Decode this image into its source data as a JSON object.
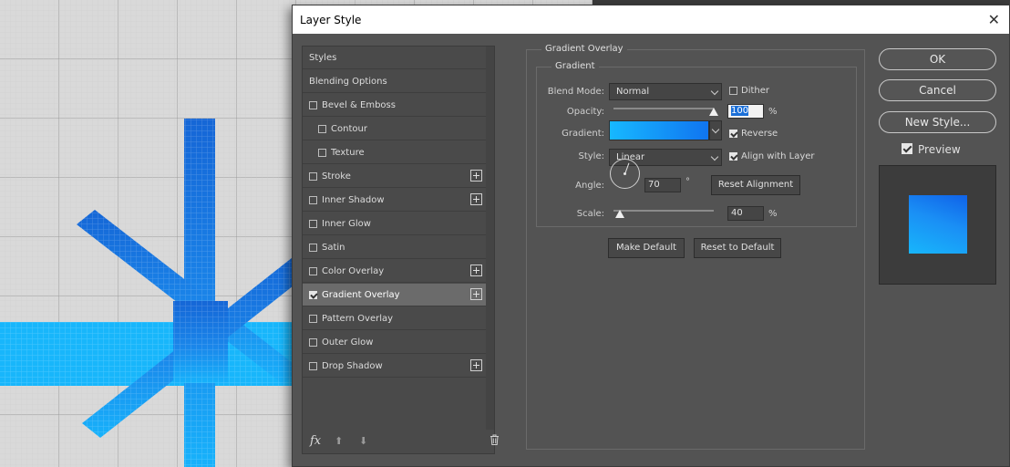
{
  "dialog": {
    "title": "Layer Style",
    "close_glyph": "✕"
  },
  "styles_list": [
    {
      "label": "Styles",
      "checkbox": false,
      "plus": false,
      "indent": 0
    },
    {
      "label": "Blending Options",
      "checkbox": false,
      "plus": false,
      "indent": 0
    },
    {
      "label": "Bevel & Emboss",
      "checkbox": true,
      "checked": false,
      "plus": false,
      "indent": 0
    },
    {
      "label": "Contour",
      "checkbox": true,
      "checked": false,
      "plus": false,
      "indent": 1
    },
    {
      "label": "Texture",
      "checkbox": true,
      "checked": false,
      "plus": false,
      "indent": 1
    },
    {
      "label": "Stroke",
      "checkbox": true,
      "checked": false,
      "plus": true,
      "indent": 0
    },
    {
      "label": "Inner Shadow",
      "checkbox": true,
      "checked": false,
      "plus": true,
      "indent": 0
    },
    {
      "label": "Inner Glow",
      "checkbox": true,
      "checked": false,
      "plus": false,
      "indent": 0
    },
    {
      "label": "Satin",
      "checkbox": true,
      "checked": false,
      "plus": false,
      "indent": 0
    },
    {
      "label": "Color Overlay",
      "checkbox": true,
      "checked": false,
      "plus": true,
      "indent": 0
    },
    {
      "label": "Gradient Overlay",
      "checkbox": true,
      "checked": true,
      "plus": true,
      "indent": 0,
      "selected": true
    },
    {
      "label": "Pattern Overlay",
      "checkbox": true,
      "checked": false,
      "plus": false,
      "indent": 0
    },
    {
      "label": "Outer Glow",
      "checkbox": true,
      "checked": false,
      "plus": false,
      "indent": 0
    },
    {
      "label": "Drop Shadow",
      "checkbox": true,
      "checked": false,
      "plus": true,
      "indent": 0
    }
  ],
  "list_footer": {
    "fx": "fx"
  },
  "gradient_overlay": {
    "group_title": "Gradient Overlay",
    "sub_title": "Gradient",
    "blend_mode_label": "Blend Mode:",
    "blend_mode_value": "Normal",
    "dither_label": "Dither",
    "dither_checked": false,
    "opacity_label": "Opacity:",
    "opacity_value": "100",
    "opacity_percent": 100,
    "percent": "%",
    "gradient_label": "Gradient:",
    "reverse_label": "Reverse",
    "reverse_checked": true,
    "style_label": "Style:",
    "style_value": "Linear",
    "align_label": "Align with Layer",
    "align_checked": true,
    "angle_label": "Angle:",
    "angle_value": "70",
    "degree": "°",
    "reset_alignment_label": "Reset Alignment",
    "scale_label": "Scale:",
    "scale_value": "40",
    "scale_percent": 40,
    "make_default_label": "Make Default",
    "reset_default_label": "Reset to Default"
  },
  "actions": {
    "ok_label": "OK",
    "cancel_label": "Cancel",
    "new_style_label": "New Style...",
    "preview_label": "Preview",
    "preview_checked": true
  },
  "colors": {
    "gradient_start": "#17b8ff",
    "gradient_end": "#1075f0",
    "dialog_bg": "#535353"
  }
}
